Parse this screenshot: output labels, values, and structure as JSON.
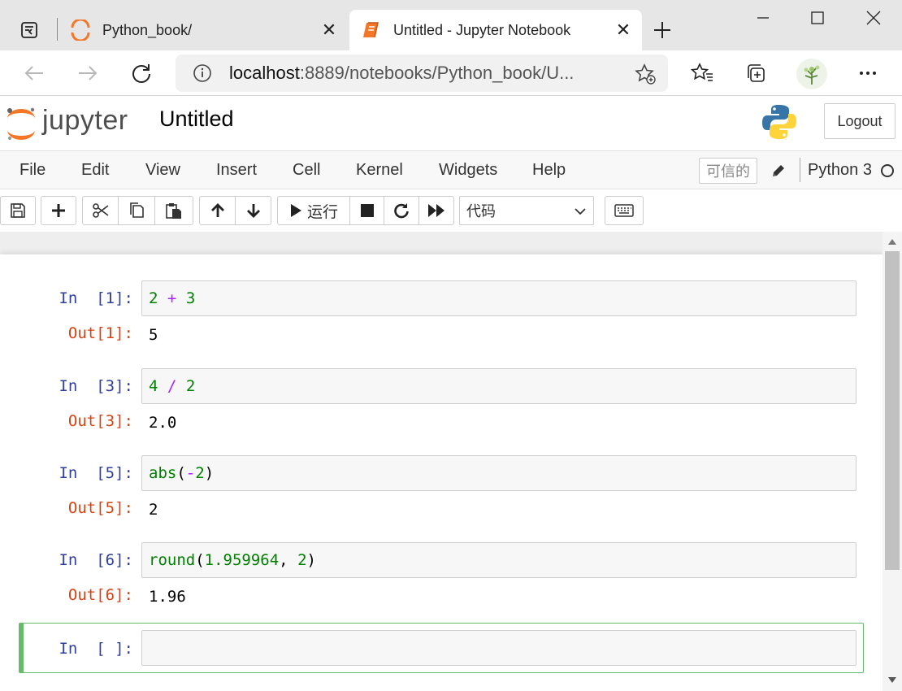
{
  "browser": {
    "tabs": [
      {
        "title": "Python_book/",
        "active": false
      },
      {
        "title": "Untitled - Jupyter Notebook",
        "active": true
      }
    ],
    "address": {
      "host": "localhost",
      "rest": ":8889/notebooks/Python_book/U..."
    }
  },
  "jupyter": {
    "logo_text": "jupyter",
    "notebook_title": "Untitled",
    "logout_label": "Logout",
    "menu": [
      "File",
      "Edit",
      "View",
      "Insert",
      "Cell",
      "Kernel",
      "Widgets",
      "Help"
    ],
    "trusted_label": "可信的",
    "kernel_name": "Python 3",
    "toolbar": {
      "run_label": "运行",
      "cell_type": "代码"
    }
  },
  "cells": [
    {
      "in_prompt": "In  [1]:",
      "out_prompt": "Out[1]:",
      "tokens": [
        [
          "num",
          "2"
        ],
        [
          "p",
          " "
        ],
        [
          "op",
          "+"
        ],
        [
          "p",
          " "
        ],
        [
          "num",
          "3"
        ]
      ],
      "output": "5"
    },
    {
      "in_prompt": "In  [3]:",
      "out_prompt": "Out[3]:",
      "tokens": [
        [
          "num",
          "4"
        ],
        [
          "p",
          " "
        ],
        [
          "op",
          "/"
        ],
        [
          "p",
          " "
        ],
        [
          "num",
          "2"
        ]
      ],
      "output": "2.0"
    },
    {
      "in_prompt": "In  [5]:",
      "out_prompt": "Out[5]:",
      "tokens": [
        [
          "fn",
          "abs"
        ],
        [
          "p",
          "("
        ],
        [
          "op",
          "-"
        ],
        [
          "num",
          "2"
        ],
        [
          "p",
          ")"
        ]
      ],
      "output": "2"
    },
    {
      "in_prompt": "In  [6]:",
      "out_prompt": "Out[6]:",
      "tokens": [
        [
          "fn",
          "round"
        ],
        [
          "p",
          "("
        ],
        [
          "num",
          "1.959964"
        ],
        [
          "p",
          ", "
        ],
        [
          "num",
          "2"
        ],
        [
          "p",
          ")"
        ]
      ],
      "output": "1.96"
    },
    {
      "in_prompt": "In  [ ]:"
    }
  ],
  "colors": {
    "accent_orange": "#f37726",
    "selected_cell_border": "#66bb6a",
    "in_prompt": "#303f9f",
    "out_prompt": "#d84315"
  }
}
